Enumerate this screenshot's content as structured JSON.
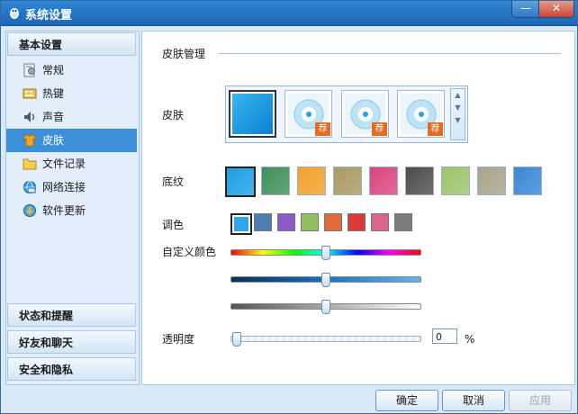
{
  "window": {
    "title": "系统设置",
    "min_label": "—",
    "close_label": "✕"
  },
  "sidebar": {
    "top_group": "基本设置",
    "items": [
      {
        "label": "常规",
        "icon": "general-settings-icon"
      },
      {
        "label": "热键",
        "icon": "hotkey-icon"
      },
      {
        "label": "声音",
        "icon": "speaker-icon"
      },
      {
        "label": "皮肤",
        "icon": "shirt-icon",
        "active": true
      },
      {
        "label": "文件记录",
        "icon": "folder-icon"
      },
      {
        "label": "网络连接",
        "icon": "network-icon"
      },
      {
        "label": "软件更新",
        "icon": "update-icon"
      }
    ],
    "bottom_groups": [
      "状态和提醒",
      "好友和聊天",
      "安全和隐私"
    ]
  },
  "skin_manager": {
    "section_title": "皮肤管理",
    "skin_label": "皮肤",
    "skins": [
      {
        "selected": true
      },
      {
        "badge": "荐"
      },
      {
        "badge": "荐"
      },
      {
        "badge": "荐"
      }
    ],
    "texture_label": "底纹",
    "textures": [
      "#1d9fe4",
      "#3e8f5a",
      "#f2a12a",
      "#a99a62",
      "#d8457e",
      "#4e4b4c",
      "#9cc46b",
      "#a8a28c",
      "#3a86d6"
    ],
    "color_label": "调色",
    "swatches": [
      "#2fa6e8",
      "#4b7fb3",
      "#8b5cc8",
      "#8fc25f",
      "#e06a3a",
      "#d93a35",
      "#d9648c",
      "#7b7b7b"
    ],
    "custom_color_label": "自定义颜色",
    "hue_level": 0.5,
    "saturation_level": 0.5,
    "brightness_level": 0.5,
    "transparency_label": "透明度",
    "transparency_value": "0",
    "percent_sign": "%"
  },
  "footer": {
    "ok": "确定",
    "cancel": "取消",
    "apply": "应用"
  },
  "colors": {
    "accent": "#3d8fd8",
    "titlebar": "#2f86d4"
  }
}
